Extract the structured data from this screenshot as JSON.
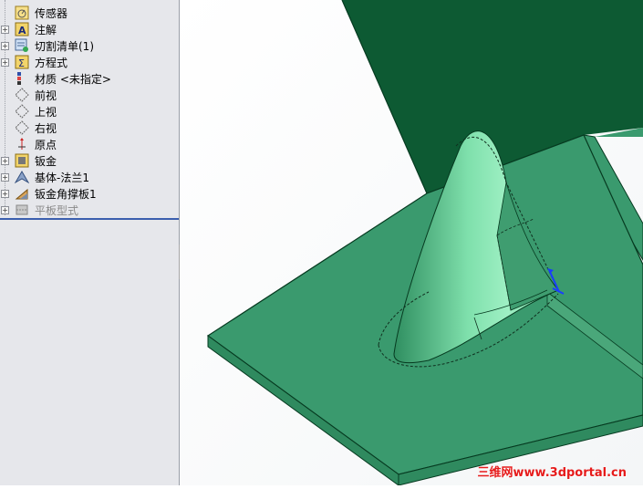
{
  "tree": {
    "items": [
      {
        "label": "传感器",
        "icon": "sensor-icon",
        "expandable": false
      },
      {
        "label": "注解",
        "icon": "annotation-icon",
        "expandable": true
      },
      {
        "label": "切割清单(1)",
        "icon": "cutlist-icon",
        "expandable": true
      },
      {
        "label": "方程式",
        "icon": "equation-icon",
        "expandable": true
      },
      {
        "label": "材质 <未指定>",
        "icon": "material-icon",
        "expandable": false
      },
      {
        "label": "前视",
        "icon": "plane-icon",
        "expandable": false
      },
      {
        "label": "上视",
        "icon": "plane-icon",
        "expandable": false
      },
      {
        "label": "右视",
        "icon": "plane-icon",
        "expandable": false
      },
      {
        "label": "原点",
        "icon": "origin-icon",
        "expandable": false
      },
      {
        "label": "钣金",
        "icon": "sheetmetal-icon",
        "expandable": true
      },
      {
        "label": "基体-法兰1",
        "icon": "base-flange-icon",
        "expandable": true
      },
      {
        "label": "钣金角撑板1",
        "icon": "gusset-icon",
        "expandable": true
      },
      {
        "label": "平板型式",
        "icon": "flat-pattern-icon",
        "expandable": true,
        "suppressed": true
      }
    ]
  },
  "watermark": "三维网www.3dportal.cn",
  "colors": {
    "panel_bg": "#e6e7eb",
    "rollback_bar": "#3b5fae",
    "plate_face": "#3a9a6e",
    "plate_dark": "#0b5430",
    "gusset_light": "#8ee6b6",
    "watermark": "#e61b1b"
  }
}
